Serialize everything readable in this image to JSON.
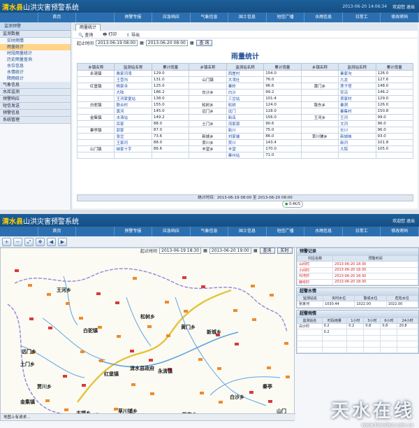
{
  "app": {
    "title_county": "清水县",
    "title_rest": "山洪灾害预警系统",
    "date_top": "2013-06-20 14:06:34",
    "user_text": "欢迎您 退出"
  },
  "nav": [
    "",
    "首页",
    "",
    "预警专报",
    "应急响应",
    "气象信息",
    "国土信息",
    "短信广播",
    "水雨信息",
    "日常工",
    "修改密码"
  ],
  "screen1": {
    "sidebar_header": "监测预警",
    "groups": [
      {
        "label": "监测数据",
        "items": [
          "实时雨情",
          "雨量统计",
          "时段雨量统计",
          "历史雨量查询",
          "水位信息",
          "水情统计",
          "降雨统计"
        ]
      },
      {
        "label": "气象信息",
        "items": []
      },
      {
        "label": "水库监测",
        "items": []
      },
      {
        "label": "预警响应",
        "items": []
      },
      {
        "label": "短信发送",
        "items": []
      },
      {
        "label": "预警信息",
        "items": []
      },
      {
        "label": "系统管理",
        "items": []
      }
    ],
    "tab_label": "雨量统计",
    "tools": {
      "query": "查询",
      "print": "打印",
      "export": "导出"
    },
    "query": {
      "start_label": "起止时间",
      "start_value": "2013-06-19 08:00",
      "end_value": "2013-06-20 08:00",
      "button": "查 询"
    },
    "table_title": "雨量统计",
    "headers": [
      "乡镇名称",
      "监测站名称",
      "累计雨量"
    ],
    "columns": [
      [
        [
          "永清镇",
          "桑家河湾",
          "129.0"
        ],
        [
          "",
          "王营沟",
          "131.0"
        ],
        [
          "红堡镇",
          "杨家寺",
          "125.0"
        ],
        [
          "",
          "大陆",
          "186.2"
        ],
        [
          "",
          "王河家堡站",
          "138.0"
        ],
        [
          "白驼镇",
          "联合村",
          "155.0"
        ],
        [
          "",
          "黄河",
          "145.0"
        ],
        [
          "金集镇",
          "水清站",
          "149.2"
        ],
        [
          "",
          "百家",
          "88.0"
        ],
        [
          "秦亭镇",
          "郭家",
          "87.0"
        ],
        [
          "",
          "张岔",
          "73.6"
        ],
        [
          "",
          "王家河",
          "88.0"
        ],
        [
          "山门镇",
          "峡家十字",
          "86.6"
        ]
      ],
      [
        [
          "",
          "西崖村",
          "154.0"
        ],
        [
          "山门镇",
          "大湾社",
          "76.0"
        ],
        [
          "",
          "秦岭",
          "96.6"
        ],
        [
          "白沙乡",
          "白沙",
          "99.2"
        ],
        [
          "",
          "三岔站",
          "101.4"
        ],
        [
          "松树乡",
          "松树",
          "124.0"
        ],
        [
          "远门乡",
          "远门",
          "118.0"
        ],
        [
          "",
          "新店",
          "156.0"
        ],
        [
          "土门乡",
          "流家源",
          "90.6"
        ],
        [
          "",
          "新川",
          "75.0"
        ],
        [
          "新城乡",
          "刘家端",
          "86.0"
        ],
        [
          "贾川乡",
          "贾川",
          "143.4"
        ],
        [
          "丰望乡",
          "丰望",
          "170.0"
        ],
        [
          "",
          "秦州站",
          "71.0"
        ]
      ],
      [
        [
          "",
          "秦家沟",
          "126.0"
        ],
        [
          "",
          "九龙",
          "127.6"
        ],
        [
          "黄门乡",
          "莲子塔",
          "148.0"
        ],
        [
          "",
          "安沿",
          "146.2"
        ],
        [
          "",
          "贾家村",
          "129.0"
        ],
        [
          "陇东乡",
          "秦洞",
          "126.0"
        ],
        [
          "",
          "秦集村",
          "150.8"
        ],
        [
          "王河乡",
          "王河",
          "99.0"
        ],
        [
          "",
          "文河",
          "96.0"
        ],
        [
          "",
          "长川",
          "96.0"
        ],
        [
          "草川铺乡",
          "新城峡",
          "93.0"
        ],
        [
          "",
          "新河",
          "101.8"
        ],
        [
          "",
          "大院",
          "105.0"
        ]
      ]
    ],
    "footer": "统计时间：2013-06-19 08:00 至 2013-06-20 08:00",
    "tray_text": "0.4K/S"
  },
  "screen2": {
    "toolbar_icons": [
      "zoom-in-icon",
      "zoom-out-icon",
      "full-extent-icon",
      "pan-icon",
      "back-icon",
      "forward-icon"
    ],
    "query": {
      "start_label": "起止时间",
      "start_value": "2013-06-19 18:30",
      "end_value": "2013-06-20 19:00",
      "query_btn": "查询",
      "realtime_btn": "实时"
    },
    "map_labels": [
      {
        "name": "王河乡"
      },
      {
        "name": "白驼镇"
      },
      {
        "name": "黄门乡"
      },
      {
        "name": "新城乡"
      },
      {
        "name": "远门乡"
      },
      {
        "name": "土门乡"
      },
      {
        "name": "红堡镇"
      },
      {
        "name": "清水县政府"
      },
      {
        "name": "永清镇"
      },
      {
        "name": "白沙乡"
      },
      {
        "name": "贾川乡"
      },
      {
        "name": "金集镇"
      },
      {
        "name": "草川铺乡"
      },
      {
        "name": "丰望乡"
      },
      {
        "name": "陇东乡"
      },
      {
        "name": "秦亭"
      },
      {
        "name": "山门"
      },
      {
        "name": "松树乡"
      }
    ],
    "warn_panel": {
      "title": "预警记录",
      "headers": [
        "村庄名称",
        "预警时间"
      ],
      "rows": [
        [
          "山间村",
          "2013-06-20 18:30"
        ],
        [
          "小间村",
          "2013-06-20 18:30"
        ],
        [
          "代湾村",
          "2013-06-20 18:30"
        ],
        [
          "薛坨村",
          "2013-06-20 18:30"
        ]
      ]
    },
    "water_panel": {
      "title": "超警水情",
      "headers": [
        "监测站名",
        "实时水位",
        "警戒水位",
        "危险水位"
      ],
      "rows": [
        [
          "张家河",
          "1030.44",
          "1022.00",
          "1022.00"
        ]
      ]
    },
    "rain_panel": {
      "title": "超警雨情",
      "headers": [
        "监测站名",
        "时段雨量",
        "1小时",
        "3小时",
        "6小时",
        "24小时"
      ],
      "rows": [
        [
          "白沙村",
          "0.2",
          "0.2",
          "0.8",
          "0.8",
          "20.8"
        ],
        [
          "",
          "0.2",
          "",
          "",
          "",
          ""
        ],
        [
          "",
          "",
          "",
          "",
          "",
          ""
        ],
        [
          "",
          "",
          "",
          "",
          "",
          ""
        ],
        [
          "",
          "",
          "",
          "",
          "",
          ""
        ]
      ]
    },
    "status": "地图上有请求..."
  },
  "watermark": {
    "text": "天水在线",
    "url": "www.tianshui.com.cn"
  },
  "colors": {
    "banner": "#1c5f9a",
    "accent_yellow": "#ffd200",
    "warn_red": "#d11919"
  }
}
